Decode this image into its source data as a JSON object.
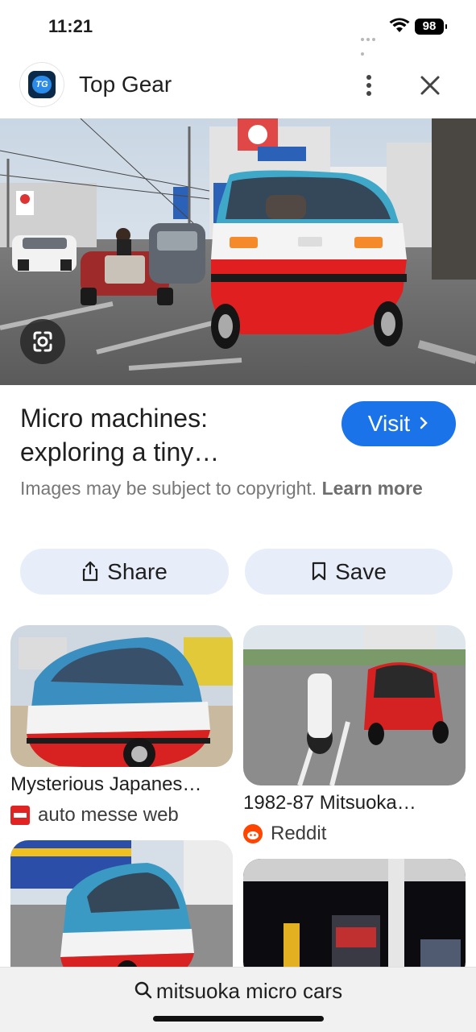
{
  "status_bar": {
    "time": "11:21",
    "battery": "98"
  },
  "header": {
    "site_name": "Top Gear",
    "logo_text": "TG"
  },
  "result": {
    "title_line1": "Micro machines:",
    "title_line2": "exploring a tiny…",
    "visit_label": "Visit",
    "copyright_text": "Images may be subject to copyright.",
    "learn_more": "Learn more"
  },
  "actions": {
    "share_label": "Share",
    "save_label": "Save"
  },
  "related": [
    {
      "title": "Mysterious Japanes…",
      "source": "auto messe web"
    },
    {
      "title": "1982-87 Mitsuoka…",
      "source": "Reddit"
    },
    {
      "title": "",
      "source": ""
    },
    {
      "title": "",
      "source": ""
    }
  ],
  "search": {
    "query": "mitsuoka micro cars"
  },
  "icons": [
    "more-vert-icon",
    "close-icon",
    "google-lens-icon",
    "share-icon",
    "bookmark-icon",
    "chevron-right-icon",
    "search-icon",
    "wifi-icon"
  ],
  "colors": {
    "accent": "#1a73e8",
    "pill_bg": "#e8eef9"
  }
}
